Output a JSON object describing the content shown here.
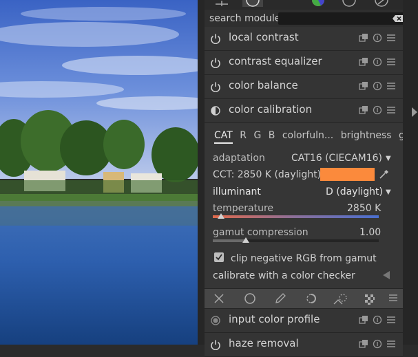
{
  "search": {
    "label": "search module",
    "placeholder": ""
  },
  "modules_above": [
    {
      "name": "local contrast"
    },
    {
      "name": "contrast equalizer"
    },
    {
      "name": "color balance"
    }
  ],
  "color_calibration": {
    "name": "color calibration",
    "tabs": [
      "CAT",
      "R",
      "G",
      "B",
      "colorfuln...",
      "brightness",
      "gray"
    ],
    "active_tab": "CAT",
    "adaptation_label": "adaptation",
    "adaptation_value": "CAT16 (CIECAM16)",
    "cct_text": "CCT: 2850 K (daylight)",
    "cct_swatch_color": "#fb8a3c",
    "illuminant_label": "illuminant",
    "illuminant_value": "D (daylight)",
    "temperature_label": "temperature",
    "temperature_value": "2850 K",
    "temperature_fraction": 0.05,
    "gamut_label": "gamut compression",
    "gamut_value": "1.00",
    "gamut_fraction": 0.2,
    "clip_label": "clip negative RGB from gamut",
    "clip_checked": true,
    "checker_label": "calibrate with a color checker"
  },
  "toolstrip_icons": [
    "close-icon",
    "circle-icon",
    "pencil-icon",
    "brush-icon",
    "parametric-mask-icon",
    "drawn-parametric-mask-icon",
    "menu-icon"
  ],
  "modules_below": [
    {
      "name": "input color profile"
    },
    {
      "name": "haze removal"
    }
  ],
  "tab_icons": [
    "active-modules-icon",
    "circle-icon",
    "color-wheel-icon",
    "circle-icon",
    "scene-referred-icon"
  ]
}
